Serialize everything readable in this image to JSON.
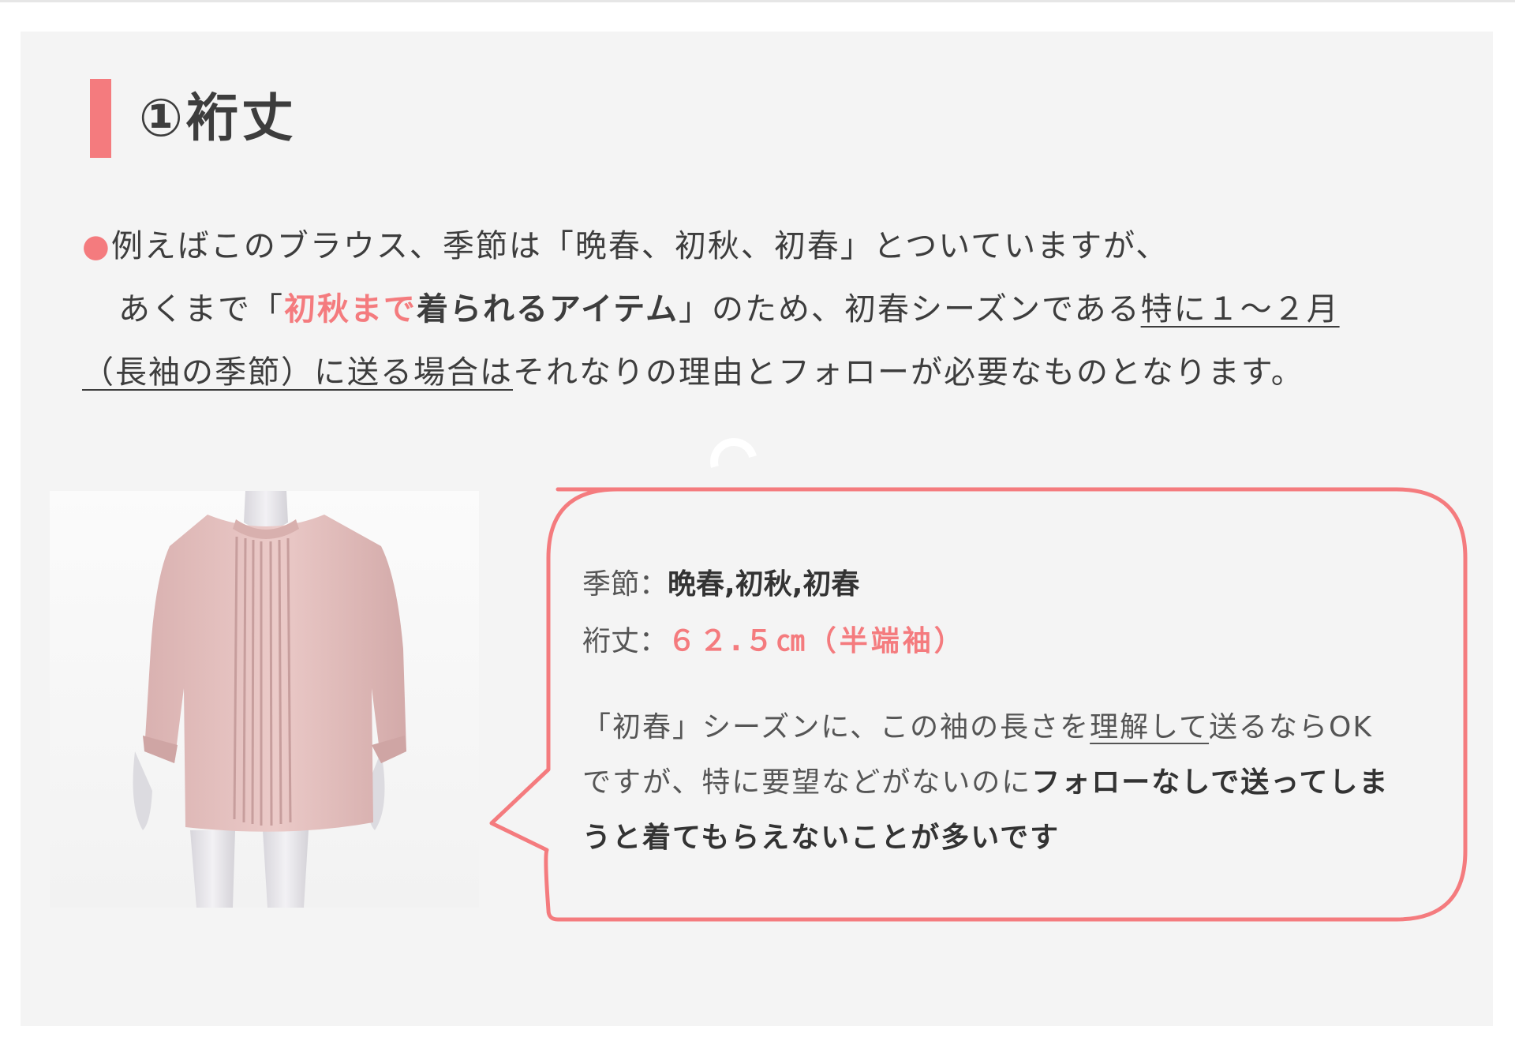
{
  "heading": {
    "title": "①裄丈"
  },
  "intro": {
    "bullet": "●",
    "l1": "例えばこのブラウス、季節は「晩春、初秋、初春」とついていますが、",
    "l2_a": "あくまで「",
    "l2_pink": "初秋まで",
    "l2_bold": "着られるアイテム",
    "l2_b": "」のため、初春シーズンである",
    "l2_ul": "特に１～２月",
    "l3_ul": "（長袖の季節）に送る場合は",
    "l3_rest": "それなりの理由とフォローが必要なものとなります。"
  },
  "product": {
    "season_label": "季節：",
    "season_value": "晩春,初秋,初春",
    "sleeve_label": "裄丈：",
    "sleeve_value": "６２.５㎝（半端袖）"
  },
  "note": {
    "l1_a": "「初春」シーズンに、この袖の長さを",
    "l1_ul": "理解して",
    "l1_b": "送るならOK",
    "l2_a": "ですが、特に要望などがないのに",
    "l2_bold": "フォローなしで送ってしま",
    "l3_bold": "うと着てもらえないことが多いです"
  },
  "colors": {
    "accent": "#f47b7e",
    "panel": "#f4f4f4",
    "text": "#3d3d3d",
    "blouse": "#e8c5c3"
  }
}
